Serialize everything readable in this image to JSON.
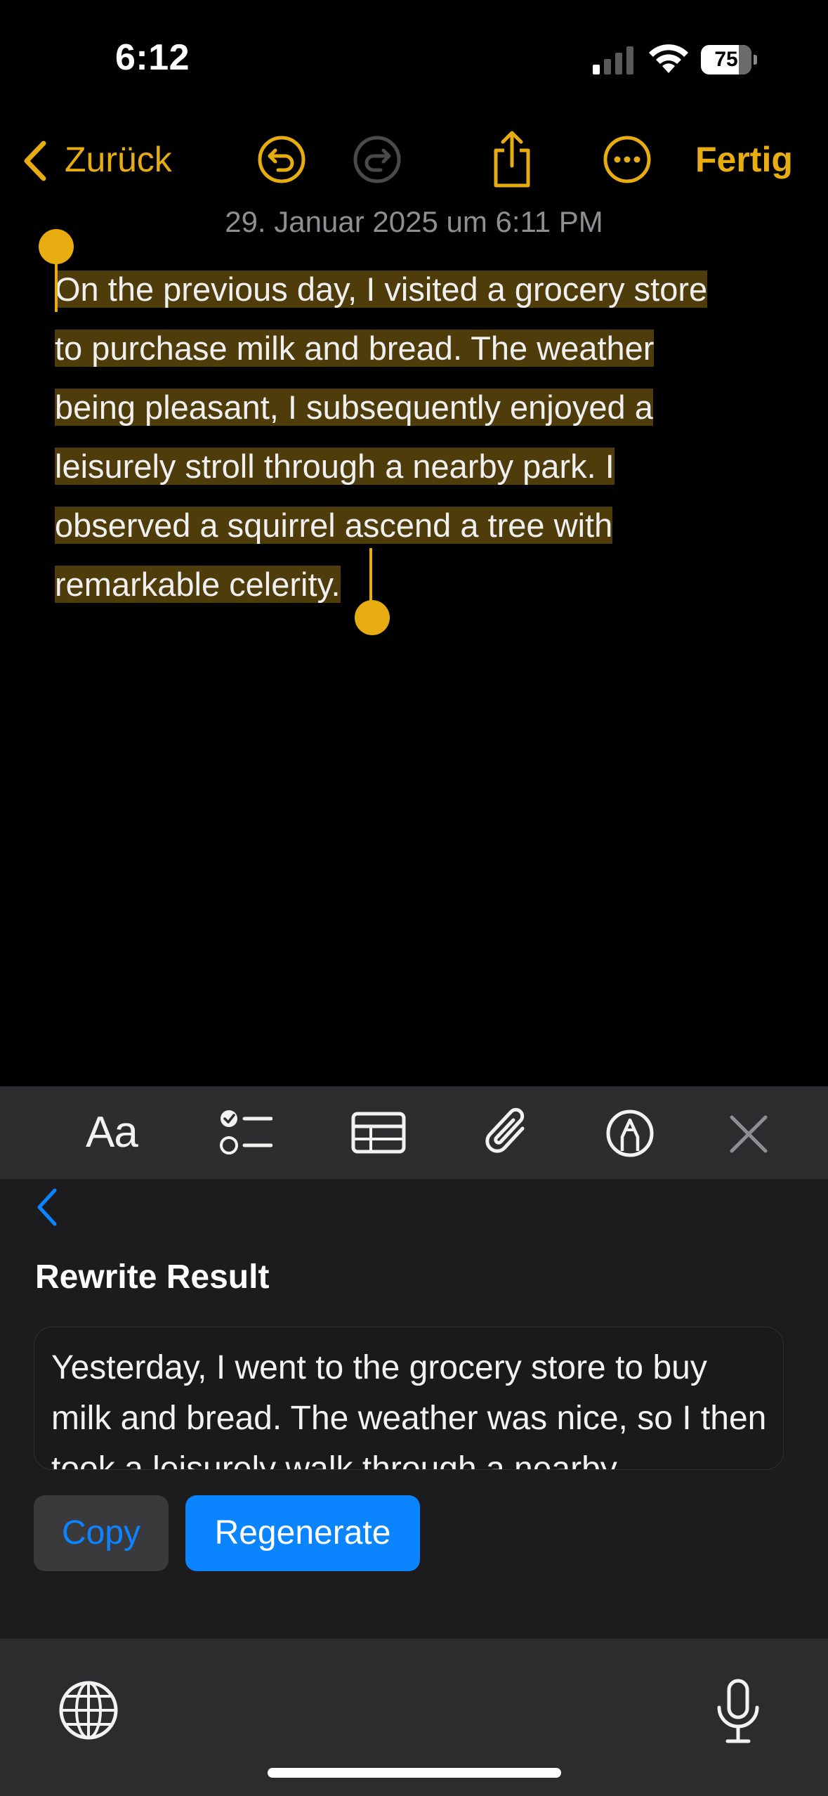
{
  "status_bar": {
    "time": "6:12",
    "battery_percent": "75",
    "battery_level": 0.75,
    "signal_bars_active": 1,
    "signal_bars_total": 4
  },
  "nav": {
    "back_label": "Zurück",
    "done_label": "Fertig",
    "accent_color": "#e6ac10",
    "icons": [
      "chevron-left-icon",
      "undo-icon",
      "redo-icon",
      "share-icon",
      "more-icon"
    ]
  },
  "note": {
    "date": "29. Januar 2025 um 6:11 PM",
    "lines": [
      "On the previous day, I visited a grocery store",
      "to purchase milk and bread.  The weather",
      "being pleasant, I subsequently enjoyed a",
      "leisurely stroll through a nearby park.  I",
      "observed a squirrel ascend a tree with",
      "remarkable celerity."
    ],
    "selection_color": "#4f3c0b"
  },
  "toolbar": {
    "format_label": "Aa",
    "icons": [
      "text-format-icon",
      "checklist-icon",
      "table-icon",
      "attachment-icon",
      "markup-icon",
      "close-icon"
    ]
  },
  "writing_tools": {
    "title": "Rewrite Result",
    "result_text": "Yesterday, I went to the grocery store to buy milk and bread. The weather was nice, so I then took a leisurely walk through a nearby",
    "copy_label": "Copy",
    "regenerate_label": "Regenerate",
    "button_color": "#0a84ff"
  },
  "keyboard": {
    "icons": [
      "globe-icon",
      "microphone-icon"
    ]
  }
}
